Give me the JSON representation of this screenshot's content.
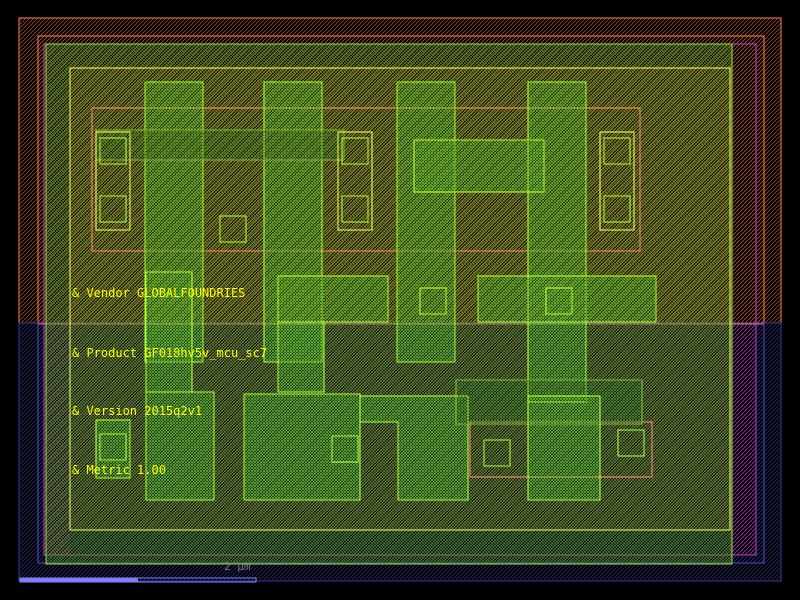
{
  "labels": {
    "vendor": "& Vendor GLOBALFOUNDRIES",
    "product": "& Product GF018hv5v_mcu_sc7",
    "version": "& Version 2015q2v1",
    "metric": "& Metric 1.00"
  },
  "scale_bar": {
    "text": "2 µm"
  },
  "colors": {
    "background": "#000000",
    "nwell_outline": "#ff7f50",
    "pwell_outline": "#3a3aa0",
    "cell_boundary": "#c040c0",
    "active_outline": "#b0ff30",
    "diffusion_outline": "#ffff60",
    "implant_outline": "#ff9070",
    "label": "#ffff00",
    "scale_bar": "#8080ff"
  }
}
